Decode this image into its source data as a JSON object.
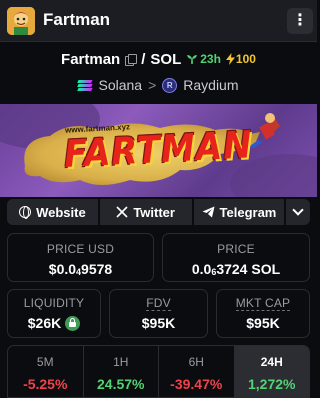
{
  "app": {
    "title": "Fartman"
  },
  "pair": {
    "base": "Fartman",
    "slash": "/",
    "quote": "SOL",
    "age": "23h",
    "boosts": "100"
  },
  "chain": {
    "network": "Solana",
    "separator": ">",
    "dex": "Raydium"
  },
  "banner": {
    "url_text": "www.fartman.xyz",
    "title_text": "FARTMAN"
  },
  "links": {
    "website": "Website",
    "twitter": "Twitter",
    "telegram": "Telegram"
  },
  "stats": {
    "price_usd": {
      "label": "PRICE USD",
      "prefix": "$0.0",
      "sub": "4",
      "rest": "9578"
    },
    "price_native": {
      "label": "PRICE",
      "prefix": "0.0",
      "sub": "6",
      "rest": "3724 SOL"
    },
    "liquidity": {
      "label": "LIQUIDITY",
      "value": "$26K"
    },
    "fdv": {
      "label": "FDV",
      "value": "$95K"
    },
    "mkt_cap": {
      "label": "MKT CAP",
      "value": "$95K"
    }
  },
  "timeframes": [
    {
      "label": "5M",
      "change": "-5.25%"
    },
    {
      "label": "1H",
      "change": "24.57%"
    },
    {
      "label": "6H",
      "change": "-39.47%"
    },
    {
      "label": "24H",
      "change": "1,272%"
    }
  ],
  "colors": {
    "positive": "#52d273",
    "negative": "#f0424b",
    "boost": "#f2c62c",
    "background": "#0b0c10"
  }
}
